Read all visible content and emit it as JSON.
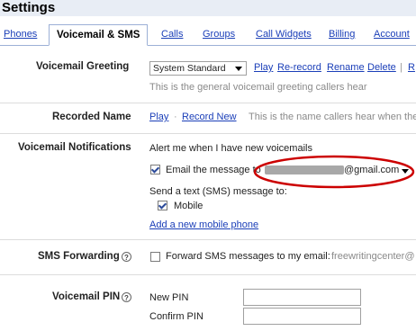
{
  "header": {
    "title": "Settings"
  },
  "tabs": [
    {
      "label": "Phones"
    },
    {
      "label": "Voicemail & SMS"
    },
    {
      "label": "Calls"
    },
    {
      "label": "Groups"
    },
    {
      "label": "Call Widgets"
    },
    {
      "label": "Billing"
    },
    {
      "label": "Account"
    }
  ],
  "greeting": {
    "label": "Voicemail Greeting",
    "selected": "System Standard",
    "actions": [
      "Play",
      "Re-record",
      "Rename",
      "Delete",
      "R"
    ],
    "hint": "This is the general voicemail greeting callers hear"
  },
  "recorded_name": {
    "label": "Recorded Name",
    "play": "Play",
    "record_new": "Record New",
    "hint": "This is the name callers hear when the"
  },
  "notifications": {
    "label": "Voicemail Notifications",
    "alert_text": "Alert me when I have new voicemails",
    "email_label": "Email the message to",
    "email_suffix": "@gmail.com",
    "sms_label": "Send a text (SMS) message to:",
    "mobile_label": "Mobile",
    "add_phone_link": "Add a new mobile phone",
    "highlight_color": "#cc0000"
  },
  "sms_forwarding": {
    "label": "SMS Forwarding",
    "help_symbol": "?",
    "text": "Forward SMS messages to my email:",
    "email": "freewritingcenter@"
  },
  "pin": {
    "label": "Voicemail PIN",
    "help_symbol": "?",
    "new_label": "New PIN",
    "confirm_label": "Confirm PIN"
  }
}
